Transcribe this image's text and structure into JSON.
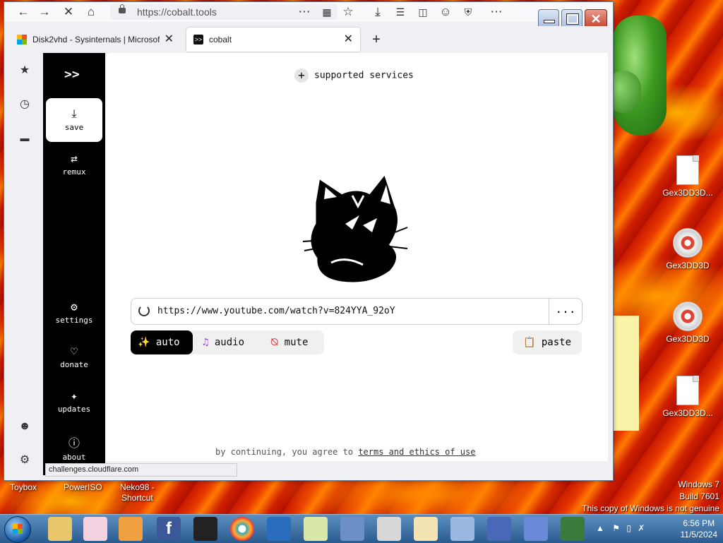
{
  "browser": {
    "url": "https://cobalt.tools",
    "tabs": [
      {
        "title": "Disk2vhd - Sysinternals | Microsoft",
        "active": false
      },
      {
        "title": "cobalt",
        "active": true
      }
    ],
    "status_text": "challenges.cloudflare.com"
  },
  "cobalt": {
    "logo": ">>",
    "nav": {
      "save": "save",
      "remux": "remux",
      "settings": "settings",
      "donate": "donate",
      "updates": "updates",
      "about": "about"
    },
    "supported_services": "supported services",
    "input_url": "https://www.youtube.com/watch?v=824YYA_92oY",
    "more_label": "...",
    "modes": {
      "auto": "auto",
      "audio": "audio",
      "mute": "mute"
    },
    "paste": "paste",
    "footer_prefix": "by continuing, you agree to",
    "footer_link": "terms and ethics of use"
  },
  "desktop": {
    "icons_right": [
      {
        "label": "Gex3DD3D...",
        "type": "file"
      },
      {
        "label": "Gex3DD3D",
        "type": "disc"
      },
      {
        "label": "Gex3DD3D",
        "type": "disc"
      },
      {
        "label": "Gex3DD3D...",
        "type": "file"
      }
    ],
    "bottom_labels": {
      "toybox": "Toybox",
      "poweriso": "PowerISO",
      "neko_line1": "Neko98 -",
      "neko_line2": "Shortcut"
    },
    "watermark": {
      "line1": "Windows 7",
      "line2": "Build 7601",
      "line3": "This copy of Windows is not genuine"
    }
  },
  "taskbar": {
    "time": "6:56 PM",
    "date": "11/5/2024"
  },
  "colors": {
    "cobalt_sidebar": "#000000",
    "accent": "#000000"
  }
}
